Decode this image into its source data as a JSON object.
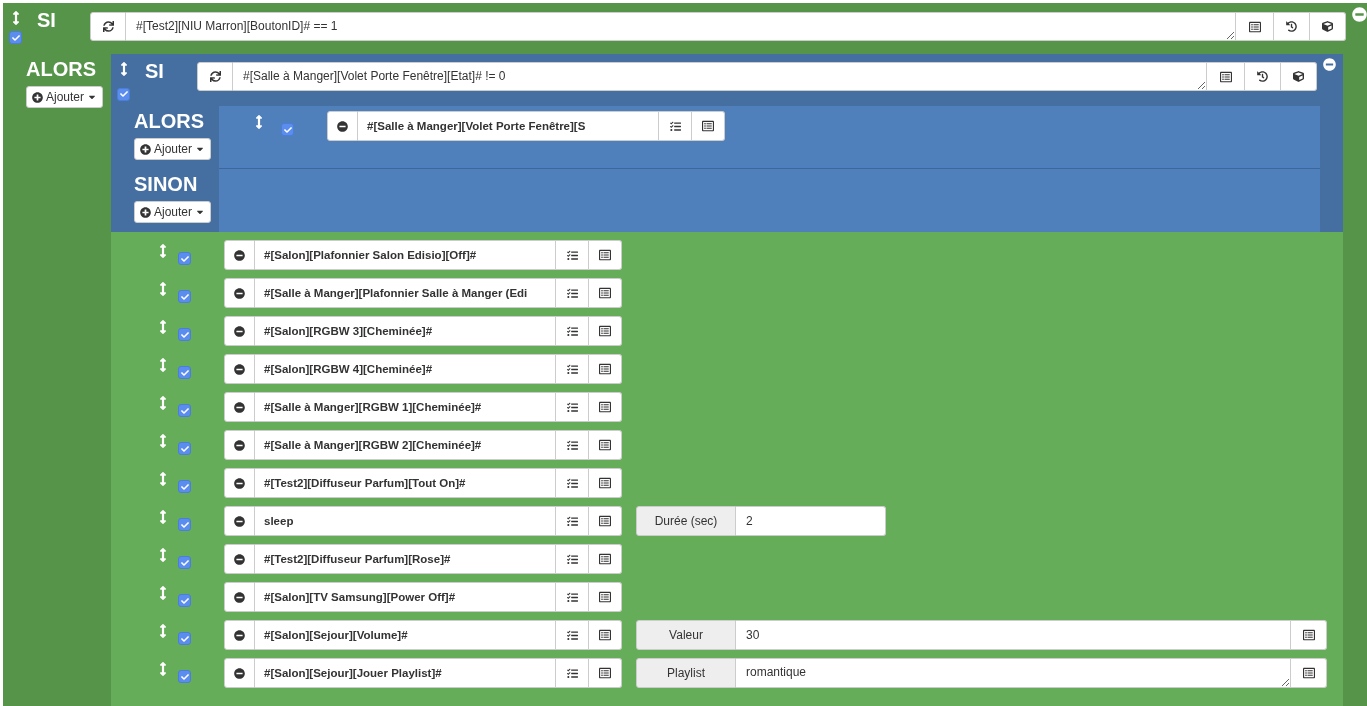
{
  "condition": {
    "label": "SI",
    "enabled": true,
    "expression": "#[Test2][NIU Marron][BoutonID]# == 1"
  },
  "then": {
    "label": "ALORS",
    "add_button": "Ajouter",
    "nested_if": {
      "label": "SI",
      "enabled": true,
      "expression": "#[Salle à Manger][Volet Porte Fenêtre][Etat]# != 0",
      "then": {
        "label": "ALORS",
        "add_button": "Ajouter",
        "actions": [
          {
            "enabled": true,
            "command": "#[Salle à Manger][Volet Porte Fenêtre][S"
          }
        ]
      },
      "else": {
        "label": "SINON",
        "add_button": "Ajouter"
      }
    },
    "actions": [
      {
        "enabled": true,
        "command": "#[Salon][Plafonnier Salon Edisio][Off]#"
      },
      {
        "enabled": true,
        "command": "#[Salle à Manger][Plafonnier Salle à Manger (Edi"
      },
      {
        "enabled": true,
        "command": "#[Salon][RGBW 3][Cheminée]#"
      },
      {
        "enabled": true,
        "command": "#[Salon][RGBW 4][Cheminée]#"
      },
      {
        "enabled": true,
        "command": "#[Salle à Manger][RGBW 1][Cheminée]#"
      },
      {
        "enabled": true,
        "command": "#[Salle à Manger][RGBW 2][Cheminée]#"
      },
      {
        "enabled": true,
        "command": "#[Test2][Diffuseur Parfum][Tout On]#"
      },
      {
        "enabled": true,
        "command": "sleep",
        "option": {
          "kind": "short",
          "label": "Durée (sec)",
          "value": "2"
        }
      },
      {
        "enabled": true,
        "command": "#[Test2][Diffuseur Parfum][Rose]#"
      },
      {
        "enabled": true,
        "command": "#[Salon][TV Samsung][Power Off]#"
      },
      {
        "enabled": true,
        "command": "#[Salon][Sejour][Volume]#",
        "option": {
          "kind": "wide",
          "label": "Valeur",
          "value": "30"
        }
      },
      {
        "enabled": true,
        "command": "#[Salon][Sejour][Jouer Playlist]#",
        "option": {
          "kind": "textarea",
          "label": "Playlist",
          "value": "romantique"
        }
      }
    ]
  }
}
